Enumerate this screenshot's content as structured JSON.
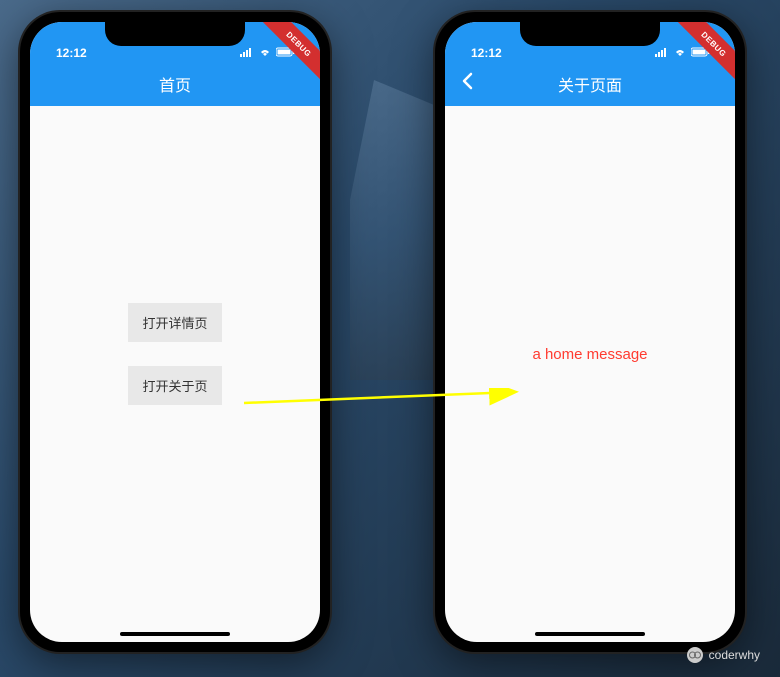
{
  "left_phone": {
    "status": {
      "time": "12:12"
    },
    "debug_label": "DEBUG",
    "app_bar": {
      "title": "首页"
    },
    "buttons": {
      "detail": "打开详情页",
      "about": "打开关于页"
    }
  },
  "right_phone": {
    "status": {
      "time": "12:12"
    },
    "debug_label": "DEBUG",
    "app_bar": {
      "title": "关于页面"
    },
    "message": "a home message"
  },
  "watermark": {
    "author": "coderwhy"
  },
  "colors": {
    "primary": "#2196f3",
    "debug": "#d32f2f",
    "message": "#ff3b30",
    "arrow": "#ffff00"
  }
}
